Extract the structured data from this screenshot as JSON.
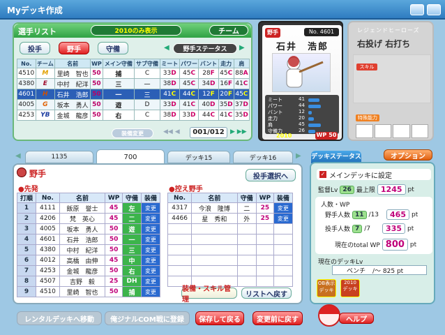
{
  "window": {
    "title": "Myデッキ作成"
  },
  "player_list": {
    "title": "選手リスト",
    "filter": "2010のみ表示",
    "team_button": "チーム",
    "tabs": {
      "fielder": "野手",
      "pitcher": "投手",
      "defense": "守備"
    },
    "status_label": "野手ステータス",
    "headers": [
      "No.",
      "チーム",
      "名前",
      "WP",
      "メイン守備",
      "サブ守備",
      "ミート",
      "パワー",
      "バント",
      "走力",
      "肩"
    ],
    "rows": [
      {
        "no": "4510",
        "team": "M",
        "name": "里崎　智也",
        "wp": "50",
        "main": "捕",
        "sub": "C",
        "meet": "33",
        "meetr": "D",
        "pow": "45",
        "powr": "C",
        "bunt": "28",
        "buntr": "F",
        "spd": "45",
        "spdr": "C",
        "arm": "88",
        "armr": "A",
        "tc": "#e0a000"
      },
      {
        "no": "4380",
        "team": "E",
        "name": "中村　紀洋",
        "wp": "50",
        "main": "三",
        "sub": "一",
        "subr": "C",
        "meet": "38",
        "meetr": "D",
        "pow": "45",
        "powr": "C",
        "bunt": "34",
        "buntr": "D",
        "spd": "16",
        "spdr": "F",
        "arm": "41",
        "armr": "C",
        "tc": "#a01030"
      },
      {
        "no": "4601",
        "team": "H",
        "name": "石井　浩郎",
        "wp": "50",
        "main": "一",
        "sub": "三",
        "subr": "E",
        "meet": "41",
        "meetr": "C",
        "pow": "44",
        "powr": "C",
        "bunt": "12",
        "buntr": "F",
        "spd": "20",
        "spdr": "F",
        "arm": "45",
        "armr": "C",
        "tc": "#d05000"
      },
      {
        "no": "4005",
        "team": "G",
        "name": "坂本　勇人",
        "wp": "50",
        "main": "遊",
        "sub": "D",
        "meet": "33",
        "meetr": "D",
        "pow": "41",
        "powr": "C",
        "bunt": "40",
        "buntr": "D",
        "spd": "35",
        "spdr": "D",
        "arm": "37",
        "armr": "D",
        "tc": "#e06000"
      },
      {
        "no": "4253",
        "team": "YB",
        "name": "金城　龍彦",
        "wp": "50",
        "main": "右",
        "sub": "C",
        "meet": "38",
        "meetr": "D",
        "pow": "33",
        "powr": "D",
        "bunt": "44",
        "buntr": "C",
        "spd": "41",
        "spdr": "C",
        "arm": "35",
        "armr": "D",
        "tc": "#1a3ca0"
      }
    ],
    "equip_change": "装備変更",
    "page": "001/012"
  },
  "card": {
    "position": "野手",
    "number": "No. 4601",
    "name": "石井　浩郎",
    "year": "2010",
    "wp_label": "WP",
    "wp": "50",
    "stats": [
      {
        "label": "ミート",
        "value": "41"
      },
      {
        "label": "パワー",
        "value": "44"
      },
      {
        "label": "バント",
        "value": "12"
      },
      {
        "label": "走力",
        "value": "20"
      },
      {
        "label": "肩",
        "value": "45"
      },
      {
        "label": "守備力",
        "value": "26"
      }
    ],
    "stat_levels": [
      0.41,
      0.44,
      0.12,
      0.2,
      0.45,
      0.26
    ]
  },
  "legend": {
    "title": "レジェンドヒーローズ",
    "throws_bats": "右投げ 右打ち",
    "skill_label": "スキル",
    "special_label": "特殊能力"
  },
  "deck_tabs": [
    "1135",
    "700",
    "デッキ15",
    "デッキ16"
  ],
  "deck": {
    "section_title": "野手",
    "starter_label": "先発",
    "select_pitcher": "投手選択へ",
    "headers": [
      "打順",
      "No.",
      "名前",
      "WP",
      "守備",
      "装備"
    ],
    "starters": [
      {
        "order": "1",
        "no": "4111",
        "name": "飯原　誉士",
        "wp": "45",
        "pos": "左",
        "equip": "変更"
      },
      {
        "order": "2",
        "no": "4206",
        "name": "梵　英心",
        "wp": "45",
        "pos": "二",
        "equip": "変更"
      },
      {
        "order": "3",
        "no": "4005",
        "name": "坂本　勇人",
        "wp": "50",
        "pos": "遊",
        "equip": "変更"
      },
      {
        "order": "4",
        "no": "4601",
        "name": "石井　浩郎",
        "wp": "50",
        "pos": "一",
        "equip": "変更"
      },
      {
        "order": "5",
        "no": "4380",
        "name": "中村　紀洋",
        "wp": "50",
        "pos": "三",
        "equip": "変更"
      },
      {
        "order": "6",
        "no": "4012",
        "name": "高橋　由伸",
        "wp": "45",
        "pos": "中",
        "equip": "変更"
      },
      {
        "order": "7",
        "no": "4253",
        "name": "金城　龍彦",
        "wp": "50",
        "pos": "右",
        "equip": "変更"
      },
      {
        "order": "8",
        "no": "4507",
        "name": "吉野　毅",
        "wp": "25",
        "pos": "DH",
        "equip": "変更"
      },
      {
        "order": "9",
        "no": "4510",
        "name": "里崎　智也",
        "wp": "50",
        "pos": "捕",
        "equip": "変更"
      }
    ],
    "bench_label": "控え野手",
    "bench_headers": [
      "No.",
      "名前",
      "守備",
      "WP",
      "装備"
    ],
    "bench": [
      {
        "no": "4317",
        "name": "今浪　隆博",
        "pos": "二",
        "wp": "25",
        "equip": "変更"
      },
      {
        "no": "4466",
        "name": "星　秀和",
        "pos": "外",
        "wp": "25",
        "equip": "変更"
      }
    ],
    "skill_manage": "装備・スキル管理",
    "back_to_list": "リストへ戻す"
  },
  "deck_status": {
    "tab": "デッキステータス",
    "options": "オプション",
    "main_deck": "メインデッキに設定",
    "manager_lv_label": "監督Lv",
    "manager_lv": "26",
    "max_label": "最上限",
    "max_value": "1245",
    "pt": "pt",
    "count_label": "人数・WP",
    "fielder_label": "野手人数",
    "fielder_count": "11",
    "fielder_max": "/13",
    "fielder_pt": "465",
    "pitcher_label": "投手人数",
    "pitcher_count": "7",
    "pitcher_max": "/7",
    "pitcher_pt": "335",
    "total_label": "現在のtotal WP",
    "total": "800",
    "deck_lv_label": "現在のデッキLv",
    "deck_lv": "ベンチ",
    "deck_lv_range": "/〜 825 pt",
    "btn_ob": "OB表示\nデッキ",
    "btn_2010": "2010\nデッキ"
  },
  "footer": {
    "rental": "レンタルデッキへ移動",
    "original": "俺ジナルCOM戦に登録",
    "save": "保存して戻る",
    "discard": "変更前に戻す",
    "help": "ヘルプ"
  },
  "colors": {
    "accent": "#3cb44b",
    "wp": "#c0007a",
    "title": "#2f7cc0"
  }
}
